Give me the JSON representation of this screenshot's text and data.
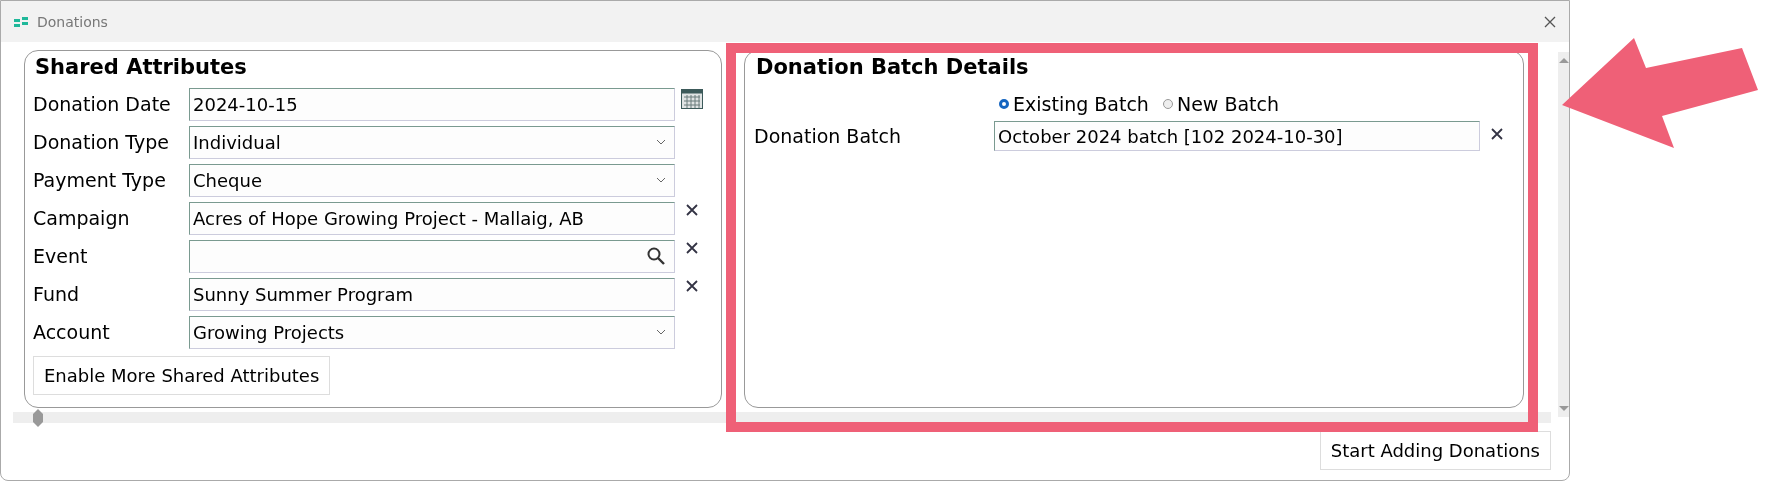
{
  "window": {
    "title": "Donations"
  },
  "shared_attributes": {
    "title": "Shared Attributes",
    "fields": [
      {
        "label": "Donation Date",
        "kind": "date",
        "value": "2024-10-15",
        "clearable": false
      },
      {
        "label": "Donation Type",
        "kind": "select",
        "value": "Individual",
        "clearable": false
      },
      {
        "label": "Payment Type",
        "kind": "select",
        "value": "Cheque",
        "clearable": false
      },
      {
        "label": "Campaign",
        "kind": "text",
        "value": "Acres of Hope Growing Project - Mallaig, AB",
        "clearable": true
      },
      {
        "label": "Event",
        "kind": "lookup",
        "clearable": true
      },
      {
        "label": "Fund",
        "kind": "text",
        "value": "Sunny Summer Program",
        "clearable": true
      },
      {
        "label": "Account",
        "kind": "select",
        "value": "Growing Projects",
        "clearable": false
      }
    ],
    "button": "Enable More Shared Attributes"
  },
  "batch_details": {
    "title": "Donation Batch Details",
    "options": [
      {
        "label": "Existing Batch",
        "selected": true
      },
      {
        "label": "New Batch",
        "selected": false
      }
    ],
    "field": {
      "label": "Donation Batch",
      "value": "October 2024 batch [102 2024-10-30]",
      "clearable": true
    }
  },
  "footer": {
    "button": "Start Adding Donations"
  }
}
